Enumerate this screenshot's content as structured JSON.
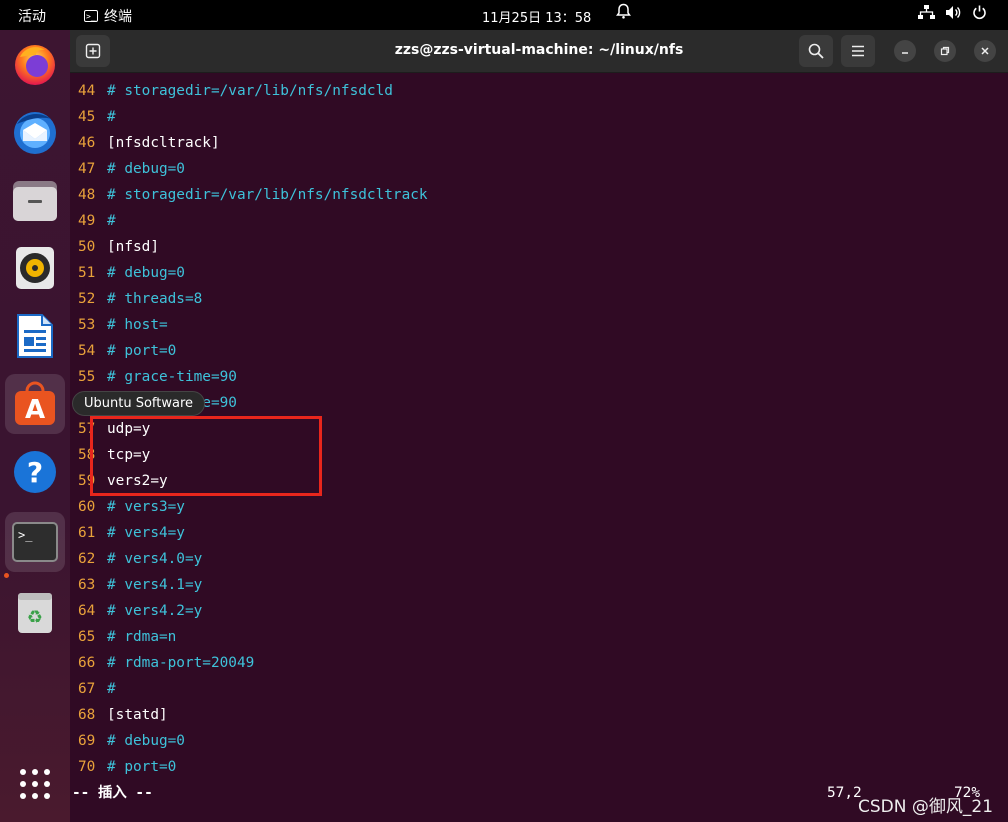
{
  "topbar": {
    "activities": "活动",
    "app_name": "终端",
    "clock": "11月25日  13：58",
    "bell_icon": "bell-icon",
    "tray_icons": [
      "network-icon",
      "volume-icon",
      "power-icon"
    ]
  },
  "dock": {
    "items": [
      {
        "name": "Firefox",
        "icon": "firefox-icon"
      },
      {
        "name": "Thunderbird",
        "icon": "thunderbird-icon"
      },
      {
        "name": "Files",
        "icon": "files-icon"
      },
      {
        "name": "Rhythmbox",
        "icon": "rhythmbox-icon"
      },
      {
        "name": "LibreOffice Writer",
        "icon": "writer-icon"
      },
      {
        "name": "Ubuntu Software",
        "icon": "software-icon"
      },
      {
        "name": "Help",
        "icon": "help-icon"
      },
      {
        "name": "Terminal",
        "icon": "terminal-icon"
      },
      {
        "name": "Trash",
        "icon": "trash-icon"
      }
    ],
    "tooltip": "Ubuntu Software"
  },
  "window": {
    "title": "zzs@zzs-virtual-machine: ~/linux/nfs"
  },
  "editor": {
    "lines": [
      {
        "n": "44",
        "text": "# storagedir=/var/lib/nfs/nfsdcld",
        "comment": true
      },
      {
        "n": "45",
        "text": "#",
        "comment": true
      },
      {
        "n": "46",
        "text": "[nfsdcltrack]",
        "comment": false
      },
      {
        "n": "47",
        "text": "# debug=0",
        "comment": true
      },
      {
        "n": "48",
        "text": "# storagedir=/var/lib/nfs/nfsdcltrack",
        "comment": true
      },
      {
        "n": "49",
        "text": "#",
        "comment": true
      },
      {
        "n": "50",
        "text": "[nfsd]",
        "comment": false
      },
      {
        "n": "51",
        "text": "# debug=0",
        "comment": true
      },
      {
        "n": "52",
        "text": "# threads=8",
        "comment": true
      },
      {
        "n": "53",
        "text": "# host=",
        "comment": true
      },
      {
        "n": "54",
        "text": "# port=0",
        "comment": true
      },
      {
        "n": "55",
        "text": "# grace-time=90",
        "comment": true
      },
      {
        "n": "56",
        "text": "# lease-time=90",
        "comment": true
      },
      {
        "n": "57",
        "text": "udp=y",
        "comment": false
      },
      {
        "n": "58",
        "text": "tcp=y",
        "comment": false
      },
      {
        "n": "59",
        "text": "vers2=y",
        "comment": false
      },
      {
        "n": "60",
        "text": "# vers3=y",
        "comment": true
      },
      {
        "n": "61",
        "text": "# vers4=y",
        "comment": true
      },
      {
        "n": "62",
        "text": "# vers4.0=y",
        "comment": true
      },
      {
        "n": "63",
        "text": "# vers4.1=y",
        "comment": true
      },
      {
        "n": "64",
        "text": "# vers4.2=y",
        "comment": true
      },
      {
        "n": "65",
        "text": "# rdma=n",
        "comment": true
      },
      {
        "n": "66",
        "text": "# rdma-port=20049",
        "comment": true
      },
      {
        "n": "67",
        "text": "#",
        "comment": true
      },
      {
        "n": "68",
        "text": "[statd]",
        "comment": false
      },
      {
        "n": "69",
        "text": "# debug=0",
        "comment": true
      },
      {
        "n": "70",
        "text": "# port=0",
        "comment": true
      }
    ]
  },
  "statusbar": {
    "mode": "-- 插入 --",
    "position": "57,2",
    "percent": "72%"
  },
  "watermark": "CSDN @御风_21"
}
